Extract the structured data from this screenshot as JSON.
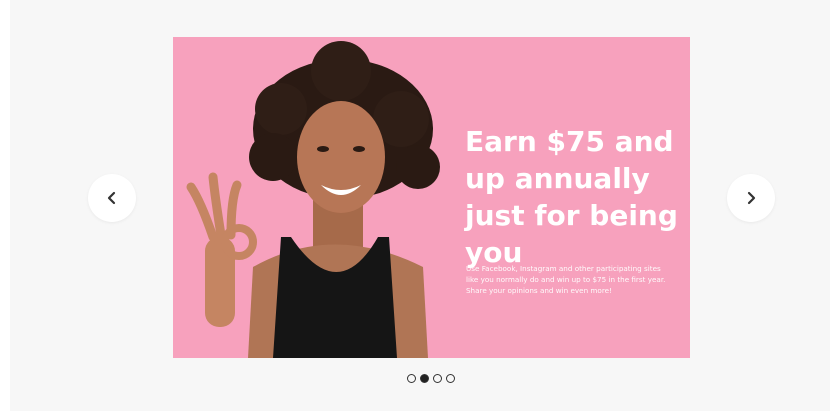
{
  "carousel": {
    "slide": {
      "headline": "Earn $75 and up annually just for being you",
      "body": "Use Facebook, Instagram and other participating sites like you normally do and win up to $75 in the first year. Share your opinions and win even more!",
      "background_color": "#f7a1bd",
      "image_alt": "woman-smiling-ok-gesture"
    },
    "prev_icon": "chevron-left-icon",
    "next_icon": "chevron-right-icon",
    "pagination": {
      "count": 4,
      "active_index": 1
    }
  }
}
